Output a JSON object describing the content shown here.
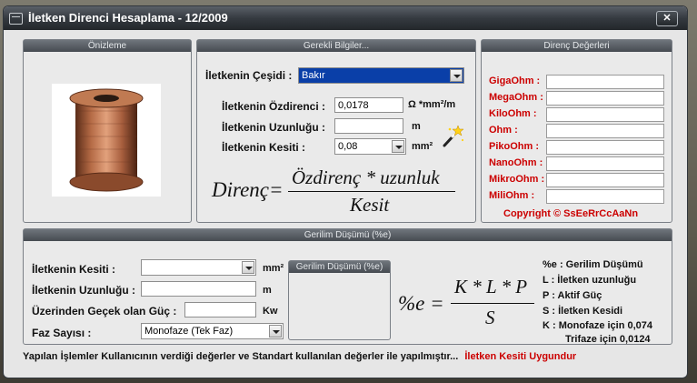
{
  "window": {
    "title": "İletken Direnci Hesaplama - 12/2009",
    "close_glyph": "✕"
  },
  "preview": {
    "header": "Önizleme"
  },
  "required": {
    "header": "Gerekli Bilgiler...",
    "type_label": "İletkenin Çeşidi :",
    "type_value": "Bakır",
    "resistivity_label": "İletkenin Özdirenci :",
    "resistivity_value": "0,0178",
    "resistivity_unit": "Ω *mm²/m",
    "length_label": "İletkenin Uzunluğu :",
    "length_value": "",
    "length_unit": "m",
    "section_label": "İletkenin Kesiti :",
    "section_value": "0,08",
    "section_unit": "mm²",
    "formula_lhs": "Direnç=",
    "formula_num": "Özdirenç * uzunluk",
    "formula_den": "Kesit"
  },
  "resistance": {
    "header": "Direnç Değerleri",
    "rows": [
      {
        "label": "GigaOhm :",
        "value": ""
      },
      {
        "label": "MegaOhm :",
        "value": ""
      },
      {
        "label": "KiloOhm :",
        "value": ""
      },
      {
        "label": "Ohm :",
        "value": ""
      },
      {
        "label": "PikoOhm :",
        "value": ""
      },
      {
        "label": "NanoOhm :",
        "value": ""
      },
      {
        "label": "MikroOhm :",
        "value": ""
      },
      {
        "label": "MiliOhm :",
        "value": ""
      }
    ],
    "copyright": "Copyright © SsEeRrCcAaNn"
  },
  "voltage_drop": {
    "header": "Gerilim Düşümü (%e)",
    "section_label": "İletkenin Kesiti :",
    "section_value": "",
    "section_unit": "mm²",
    "length_label": "İletkenin Uzunluğu :",
    "length_value": "",
    "length_unit": "m",
    "power_label": "Üzerinden Geçek olan Güç :",
    "power_value": "",
    "power_unit": "Kw",
    "phase_label": "Faz Sayısı   :",
    "phase_value": "Monofaze (Tek Faz)",
    "result_header": "Gerilim Düşümü (%e)",
    "formula_lhs": "%e =",
    "formula_num": "K * L * P",
    "formula_den": "S",
    "legend": [
      "%e : Gerilim Düşümü",
      "L : İletken uzunluğu",
      "P : Aktif Güç",
      "S : İletken Kesidi",
      "K : Monofaze için 0,074",
      "Trifaze için 0,0124"
    ]
  },
  "footer": {
    "info": "Yapılan İşlemler Kullanıcının verdiği değerler ve Standart kullanılan değerler ile yapılmıştır...",
    "status": "İletken Kesiti Uygundur"
  }
}
